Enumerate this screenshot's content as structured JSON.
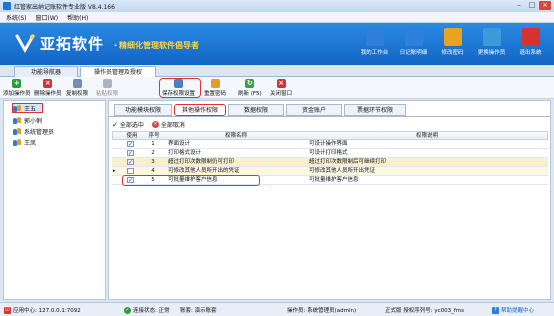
{
  "window": {
    "title": "红管家出纳记账软件专业版 V8.4.166"
  },
  "menu": [
    "系统(S)",
    "窗口(W)",
    "帮助(H)"
  ],
  "banner": {
    "brand": "亚拓软件",
    "slogan": "精细化管理软件倡导者",
    "buttons": [
      {
        "label": "我的工作台",
        "icon": "desktop-icon",
        "color": "#2f7fdc"
      },
      {
        "label": "日记账明细",
        "icon": "ledger-icon",
        "color": "#2f7fdc"
      },
      {
        "label": "修改密码",
        "icon": "key-user-icon",
        "color": "#e9a320"
      },
      {
        "label": "更换操作员",
        "icon": "switch-user-icon",
        "color": "#3c9ad8"
      },
      {
        "label": "退出系统",
        "icon": "power-icon",
        "color": "#d6322e"
      }
    ]
  },
  "nav_tabs": [
    "功能导航器",
    "操作员管理及授权"
  ],
  "toolbar": [
    {
      "label": "添加操作员",
      "icon": "add-icon",
      "color": "#2d9c3a",
      "glyph": "+",
      "disabled": false
    },
    {
      "label": "删除操作员",
      "icon": "delete-icon",
      "color": "#d6322e",
      "glyph": "×",
      "disabled": false
    },
    {
      "label": "复制权限",
      "icon": "copy-icon",
      "color": "#6f8fb6",
      "glyph": "",
      "disabled": false
    },
    {
      "label": "粘贴权限",
      "icon": "paste-icon",
      "color": "#a9b6c6",
      "glyph": "",
      "disabled": true
    },
    {
      "label": "保存权限设置",
      "icon": "save-icon",
      "color": "#4a7fc0",
      "glyph": "",
      "disabled": false
    },
    {
      "label": "重置密码",
      "icon": "reset-password-icon",
      "color": "#e0a021",
      "glyph": "",
      "disabled": false
    },
    {
      "label": "刷新 (F5)",
      "icon": "refresh-icon",
      "color": "#3aa24a",
      "glyph": "↻",
      "disabled": false
    },
    {
      "label": "关闭窗口",
      "icon": "close-window-icon",
      "color": "#d6322e",
      "glyph": "×",
      "disabled": false
    }
  ],
  "users": [
    "王五",
    "郭小俐",
    "系统管理员",
    "王凤"
  ],
  "sub_tabs": [
    "功能模块权限",
    "其他操作权限",
    "数据权限",
    "资金账户",
    "票据环节权限"
  ],
  "select_all": "全部选中",
  "deselect_all": "全部取消",
  "grid": {
    "columns": [
      "使用",
      "序号",
      "权限名称",
      "权限说明"
    ],
    "rows": [
      {
        "checked": true,
        "no": "1",
        "name": "界面设计",
        "desc": "可设计操作界面"
      },
      {
        "checked": true,
        "no": "2",
        "name": "打印格式设计",
        "desc": "可设计打印格式"
      },
      {
        "checked": true,
        "no": "3",
        "name": "超过打印次数限制仍可打印",
        "desc": "超过打印次数限制后可继续打印"
      },
      {
        "checked": false,
        "no": "4",
        "name": "可修改其他人员所开出的凭证",
        "desc": "可修改其他人员所开出凭证"
      },
      {
        "checked": true,
        "no": "5",
        "name": "可批量维护客户信息",
        "desc": "可批量维护客户信息"
      }
    ]
  },
  "status": {
    "app_center": "应用中心: 127.0.0.1:7092",
    "connection": "连接状态: 正常",
    "account": "账套: 演示账套",
    "operator": "操作员: 系统管理员(admin)",
    "edition": "正式版 授权序列号: yc003_fms",
    "help": "帮助提醒中心"
  }
}
